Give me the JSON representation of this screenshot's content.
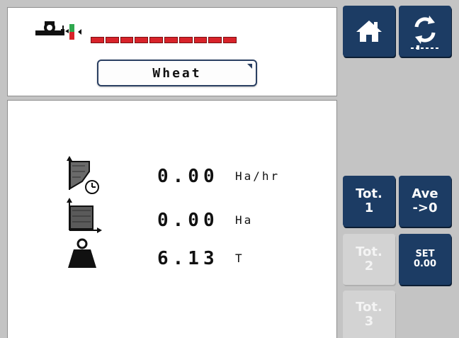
{
  "header": {
    "product": "Wheat",
    "section_count": 10,
    "colors": {
      "section_active": "#d8232a",
      "flow_green": "#2fa84f",
      "flow_red": "#d8232a"
    }
  },
  "readings": [
    {
      "icon": "work-rate-icon",
      "value": "0.00",
      "unit": "Ha/hr"
    },
    {
      "icon": "area-icon",
      "value": "0.00",
      "unit": "Ha"
    },
    {
      "icon": "weight-icon",
      "value": "6.13",
      "unit": "T"
    }
  ],
  "buttons": {
    "home": {
      "icon": "home-icon"
    },
    "refresh": {
      "icon": "refresh-icon"
    },
    "tot1": {
      "line1": "Tot.",
      "line2": "1"
    },
    "ave": {
      "line1": "Ave",
      "line2": "->0"
    },
    "tot2": {
      "line1": "Tot.",
      "line2": "2"
    },
    "set": {
      "line1": "SET",
      "line2": "0.00"
    },
    "tot3": {
      "line1": "Tot.",
      "line2": "3"
    }
  },
  "colors": {
    "button_dark": "#1c3c64",
    "button_disabled": "#d3d3d3",
    "background": "#c4c4c4"
  }
}
